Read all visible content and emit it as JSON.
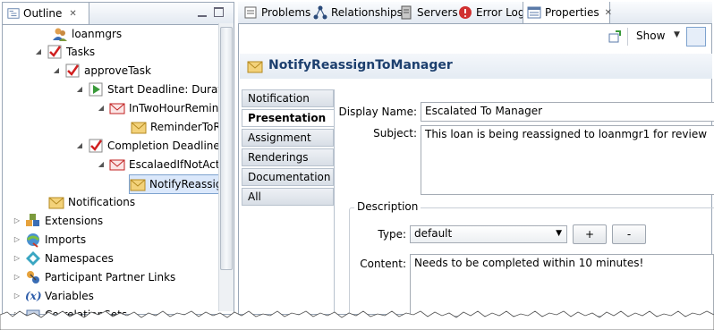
{
  "outline": {
    "tab_label": "Outline",
    "items": [
      {
        "label": "loanmgrs",
        "icon": "users-icon"
      },
      {
        "label": "Tasks",
        "icon": "tasks-icon"
      },
      {
        "label": "approveTask",
        "icon": "task-icon"
      },
      {
        "label": "Start Deadline: Duratio",
        "icon": "start-deadline-icon"
      },
      {
        "label": "InTwoHourRemind",
        "icon": "escalation-icon"
      },
      {
        "label": "ReminderToR",
        "icon": "notification-icon"
      },
      {
        "label": "Completion Deadline:",
        "icon": "completion-deadline-icon"
      },
      {
        "label": "EscalaedIfNotActe",
        "icon": "escalation-icon"
      },
      {
        "label": "NotifyReassig",
        "icon": "notification-icon"
      },
      {
        "label": "Notifications",
        "icon": "notification-icon"
      },
      {
        "label": "Extensions",
        "icon": "extensions-icon"
      },
      {
        "label": "Imports",
        "icon": "imports-icon"
      },
      {
        "label": "Namespaces",
        "icon": "namespaces-icon"
      },
      {
        "label": "Participant Partner Links",
        "icon": "partner-links-icon"
      },
      {
        "label": "Variables",
        "icon": "variables-icon"
      },
      {
        "label": "CorrelationSets",
        "icon": "correlation-icon"
      }
    ]
  },
  "views": {
    "tabs": [
      {
        "label": "Problems",
        "icon": "problems-icon"
      },
      {
        "label": "Relationships",
        "icon": "relationships-icon"
      },
      {
        "label": "Servers",
        "icon": "servers-icon"
      },
      {
        "label": "Error Log",
        "icon": "error-log-icon"
      },
      {
        "label": "Properties",
        "icon": "properties-icon"
      }
    ],
    "show_label": "Show"
  },
  "properties": {
    "title": "NotifyReassignToManager",
    "side_tabs": [
      "Notification",
      "Presentation",
      "Assignment",
      "Renderings",
      "Documentation",
      "All"
    ],
    "active_tab": "Presentation",
    "display_name_label": "Display Name:",
    "display_name_value": "Escalated To Manager",
    "subject_label": "Subject:",
    "subject_value": "This loan is being reassigned to loanmgr1 for review",
    "description_group": "Description",
    "type_label": "Type:",
    "type_value": "default",
    "add_label": "+",
    "remove_label": "-",
    "content_label": "Content:",
    "content_value": "Needs to be completed within 10 minutes!"
  }
}
